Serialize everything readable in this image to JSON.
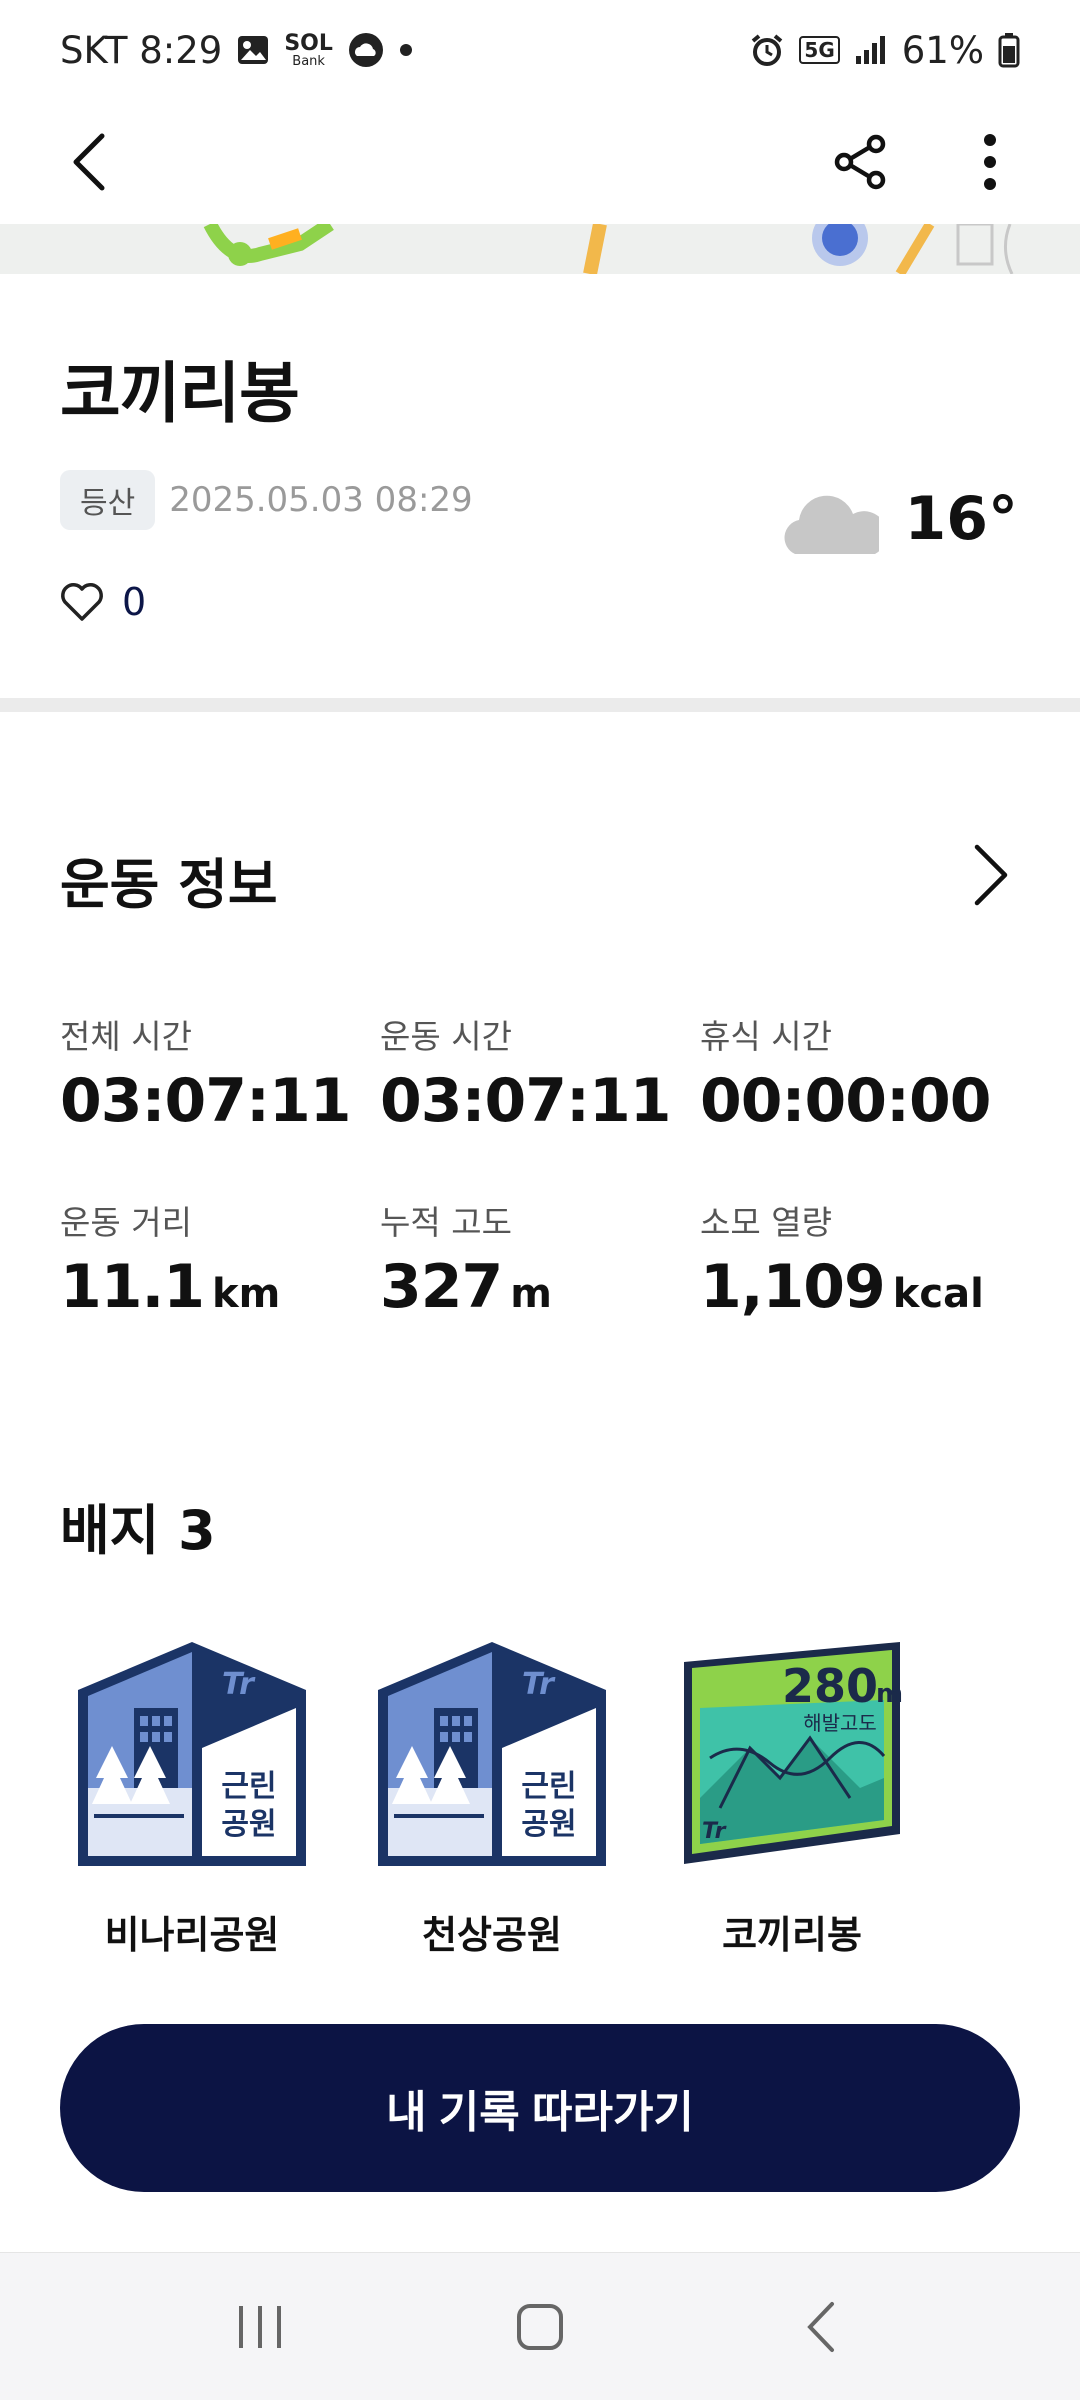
{
  "status_bar": {
    "carrier_time": "SKT 8:29",
    "bank_label": "Bank",
    "network": "5G",
    "battery": "61%",
    "icons": [
      "gallery-icon",
      "sol-bank-icon",
      "weather-cloud-icon",
      "dot-icon",
      "alarm-icon",
      "network-5g-icon",
      "signal-icon",
      "battery-icon"
    ]
  },
  "app_bar": {
    "icons": [
      "back-arrow-icon",
      "share-icon",
      "more-vertical-icon"
    ]
  },
  "summary": {
    "title": "코끼리봉",
    "tag": "등산",
    "datetime": "2025.05.03 08:29",
    "likes": "0",
    "temperature": "16°"
  },
  "exercise": {
    "section_title": "운동 정보",
    "stats": [
      {
        "label": "전체 시간",
        "value": "03:07:11",
        "unit": ""
      },
      {
        "label": "운동 시간",
        "value": "03:07:11",
        "unit": ""
      },
      {
        "label": "휴식 시간",
        "value": "00:00:00",
        "unit": ""
      },
      {
        "label": "운동 거리",
        "value": "11.1",
        "unit": "km"
      },
      {
        "label": "누적 고도",
        "value": "327",
        "unit": "m"
      },
      {
        "label": "소모 열량",
        "value": "1,109",
        "unit": "kcal"
      }
    ]
  },
  "badges": {
    "title": "배지 3",
    "items": [
      {
        "name": "비나리공원",
        "line1": "근린",
        "line2": "공원",
        "logo": "Tr"
      },
      {
        "name": "천상공원",
        "line1": "근린",
        "line2": "공원",
        "logo": "Tr"
      },
      {
        "name": "코끼리봉",
        "altitude": "280",
        "altitude_unit": "m",
        "caption": "해발고도",
        "logo": "Tr"
      }
    ]
  },
  "cta": {
    "label": "내 기록 따라가기"
  },
  "colors": {
    "navy": "#0c1444",
    "badge_blue": "#1b3466",
    "badge_green": "#8ed24a",
    "badge_teal": "#3fc2a8"
  }
}
